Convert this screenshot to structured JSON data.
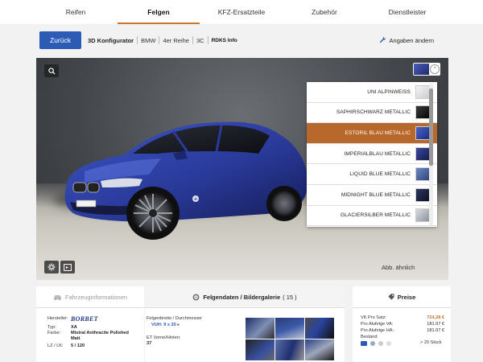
{
  "nav": {
    "tabs": [
      {
        "label": "Reifen"
      },
      {
        "label": "Felgen"
      },
      {
        "label": "KFZ-Ersatzteile"
      },
      {
        "label": "Zubehör"
      },
      {
        "label": "Dienstleister"
      }
    ]
  },
  "toolbar": {
    "back_label": "Zurück",
    "crumbs": [
      "3D Konfigurator",
      "BMW",
      "4er Reihe",
      "3C",
      "RDKS Info"
    ],
    "change_label": "Angaben ändern"
  },
  "viewer": {
    "caption": "Abb. ähnlich",
    "selected_color_hex": "#3b4fb0",
    "colors": [
      {
        "label": "UNI ALPINWEISS",
        "hex": "#e8e8ea"
      },
      {
        "label": "SAPHIRSCHWARZ METALLIC",
        "hex": "#121214"
      },
      {
        "label": "ESTORIL BLAU METALLIC",
        "hex": "#2a3fa0",
        "active": true
      },
      {
        "label": "IMPERIALBLAU METALLIC",
        "hex": "#243273"
      },
      {
        "label": "LIQUID BLUE METALLIC",
        "hex": "#3d5c9e"
      },
      {
        "label": "MIDNIGHT BLUE METALLIC",
        "hex": "#1a2140"
      },
      {
        "label": "GLACIERSILBER METALLIC",
        "hex": "#b8bcc4"
      }
    ]
  },
  "vehicle_panel": {
    "title": "Fahrzeuginformationen",
    "brand": "BORBET",
    "rows": [
      {
        "key": "Hersteller:",
        "value": ""
      },
      {
        "key": "Typ:",
        "value": "XA"
      },
      {
        "key": "Farbe:",
        "value": "Mistral Anthracite Polished"
      },
      {
        "key": "",
        "value": "Matt"
      },
      {
        "key": "LZ / LK:",
        "value": "5 / 120"
      }
    ]
  },
  "rim_panel": {
    "title": "Felgendaten / Bildergalerie",
    "count": "( 15 )",
    "width_label": "Felgenbreite / Durchmesser",
    "width_value": "VUH: 9 x 20",
    "et_label": "ET Vorne/Hinten:",
    "et_value": "37"
  },
  "price_panel": {
    "title": "Preise",
    "rows": [
      {
        "key": "VK Pro Satz:",
        "value": "724,28 €",
        "highlight": true
      },
      {
        "key": "Pro Alufelge VA:",
        "value": "181.07 €"
      },
      {
        "key": "Pro Alufelge HA:",
        "value": "181.07 €"
      }
    ],
    "stock_label": "Bestand",
    "stock_value": "> 20 Stück"
  }
}
